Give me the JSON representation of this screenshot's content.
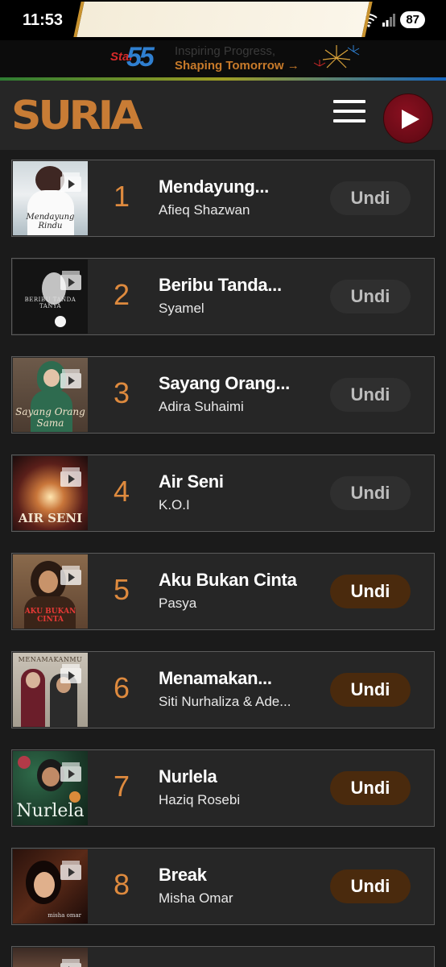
{
  "status_bar": {
    "time": "11:53",
    "network": "5",
    "battery": "87"
  },
  "banner": {
    "brand_word": "Star",
    "brand_number": "55",
    "line1": "Inspiring Progress,",
    "line2": "Shaping Tomorrow →"
  },
  "header": {
    "logo": "SURIA"
  },
  "songs": [
    {
      "rank": "1",
      "title": "Mendayung...",
      "artist": "Afieq Shazwan",
      "vote_label": "Undi",
      "vote_enabled": false,
      "cover_text": "Mendayung Rindu"
    },
    {
      "rank": "2",
      "title": "Beribu Tanda...",
      "artist": "Syamel",
      "vote_label": "Undi",
      "vote_enabled": false,
      "cover_text": "BERIBU TANDA TANYA"
    },
    {
      "rank": "3",
      "title": "Sayang Orang...",
      "artist": "Adira Suhaimi",
      "vote_label": "Undi",
      "vote_enabled": false,
      "cover_text": "Sayang Orang Sama"
    },
    {
      "rank": "4",
      "title": "Air Seni",
      "artist": "K.O.I",
      "vote_label": "Undi",
      "vote_enabled": false,
      "cover_text": "AIR SENI"
    },
    {
      "rank": "5",
      "title": "Aku Bukan Cinta",
      "artist": "Pasya",
      "vote_label": "Undi",
      "vote_enabled": true,
      "cover_text": "AKU BUKAN CINTA"
    },
    {
      "rank": "6",
      "title": "Menamakan...",
      "artist": "Siti Nurhaliza & Ade...",
      "vote_label": "Undi",
      "vote_enabled": true,
      "cover_text": "MENAMAKANMU"
    },
    {
      "rank": "7",
      "title": "Nurlela",
      "artist": "Haziq Rosebi",
      "vote_label": "Undi",
      "vote_enabled": true,
      "cover_text": "Nurlela"
    },
    {
      "rank": "8",
      "title": "Break",
      "artist": "Misha Omar",
      "vote_label": "Undi",
      "vote_enabled": true,
      "cover_text": "misha omar"
    }
  ],
  "colors": {
    "accent": "#de8a3e",
    "vote_active_bg": "#4a2a0d",
    "vote_inactive_bg": "#2f2f2f",
    "row_bg": "#262626",
    "play_button": "#7a0d1a"
  }
}
